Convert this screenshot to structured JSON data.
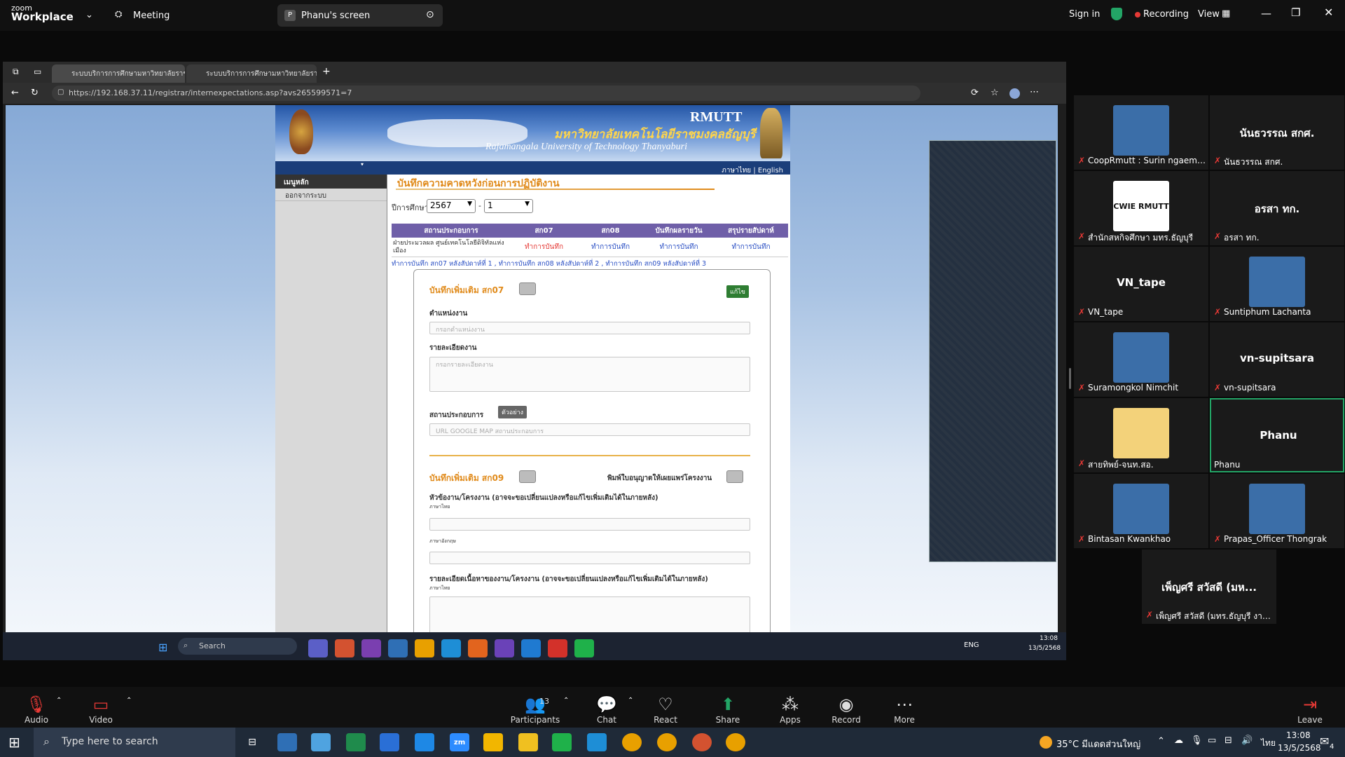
{
  "zoom_top": {
    "brand_line1": "zoom",
    "brand_line2": "Workplace",
    "meeting_label": "Meeting",
    "share_badge": "P",
    "share_label": "Phanu's screen",
    "sign_in": "Sign in",
    "recording": "Recording",
    "view": "View"
  },
  "browser": {
    "tabs": [
      {
        "title": "ระบบบริการการศึกษามหาวิทยาลัยราช..."
      },
      {
        "title": "ระบบบริการการศึกษามหาวิทยาลัยราช..."
      }
    ],
    "url": "https://192.168.37.11/registrar/internexpectations.asp?avs265599571=7"
  },
  "site": {
    "rmutt": "RMUTT",
    "thai_name": "มหาวิทยาลัยเทคโนโลยีราชมงคลธัญบุรี",
    "eng_name": "Rajamangala University of Technology Thanyaburi",
    "lang": "ภาษาไทย | English",
    "sidebar_header": "เมนูหลัก",
    "sidebar_item": "ออกจากระบบ",
    "page_title": "บันทึกความคาดหวังก่อนการปฏิบัติงาน",
    "year_label": "ปีการศึกษา",
    "year_value": "2567",
    "term_value": "1",
    "table_headers": [
      "สถานประกอบการ",
      "สก07",
      "สก08",
      "บันทึกผลรายวัน",
      "สรุปรายสัปดาห์"
    ],
    "table_row": {
      "company": "ฝ่ายประมวลผล ศูนย์เทคโนโลยีดิจิทัลแห่งเมือง",
      "c1": "ทำการบันทึก",
      "c2": "ทำการบันทึก",
      "c3": "ทำการบันทึก",
      "c4": "ทำการบันทึก"
    },
    "note": "ทำการบันทึก สก07 หลังสัปดาห์ที่ 1 , ทำการบันทึก สก08 หลังสัปดาห์ที่ 2 , ทำการบันทึก สก09 หลังสัปดาห์ที่ 3",
    "form": {
      "sec1_title": "บันทึกเพิ่มเติม สก07",
      "edit_btn": "แก้ไข",
      "position_label": "ตำแหน่งงาน",
      "position_ph": "กรอกตำแหน่งงาน",
      "detail_label": "รายละเอียดงาน",
      "detail_ph": "กรอกรายละเอียดงาน",
      "company_label": "สถานประกอบการ",
      "example_btn": "ตัวอย่าง",
      "map_ph": "URL GOOGLE MAP สถานประกอบการ",
      "sec2_title": "บันทึกเพิ่มเติม สก09",
      "print_consent": "พิมพ์ใบอนุญาตให้เผยแพร่โครงงาน",
      "project_label": "หัวข้องาน/โครงงาน (อาจจะขอเปลี่ยนแปลงหรือแก้ไขเพิ่มเติมได้ในภายหลัง)",
      "thai_small": "ภาษาไทย",
      "eng_small": "ภาษาอังกฤษ",
      "content_label": "รายละเอียดเนื้อหาของงาน/โครงงาน (อาจจะขอเปลี่ยนแปลงหรือแก้ไขเพิ่มเติมได้ในภายหลัง)",
      "thai_small2": "ภาษาไทย"
    }
  },
  "inner_taskbar": {
    "search": "Search",
    "lang": "ENG",
    "time": "13:08",
    "date": "13/5/2568"
  },
  "participants": [
    {
      "name": "CoopRmutt : Surin ngaemn...",
      "type": "photo",
      "big": ""
    },
    {
      "name": "นันธวรรณ สกศ.",
      "type": "name",
      "big": "นันธวรรณ สกศ."
    },
    {
      "name": "สำนักสหกิจศึกษา มทร.ธัญบุรี",
      "type": "logo",
      "big": "CWIE RMUTT"
    },
    {
      "name": "อรสา ทก.",
      "type": "name",
      "big": "อรสา ทก."
    },
    {
      "name": "VN_tape",
      "type": "name",
      "big": "VN_tape"
    },
    {
      "name": "Suntiphum Lachanta",
      "type": "photo",
      "big": ""
    },
    {
      "name": "Suramongkol Nimchit",
      "type": "photo",
      "big": ""
    },
    {
      "name": "vn-supitsara",
      "type": "name",
      "big": "vn-supitsara"
    },
    {
      "name": "สายทิพย์-จนท.สอ.",
      "type": "cartoon",
      "big": ""
    },
    {
      "name": "Phanu",
      "type": "active",
      "big": "Phanu"
    },
    {
      "name": "Bintasan Kwankhao",
      "type": "photo",
      "big": ""
    },
    {
      "name": "Prapas_Officer Thongrak",
      "type": "photo",
      "big": ""
    },
    {
      "name": "เพ็ญศรี สวัสดี (มทร.ธัญบุรี งาน...",
      "type": "name",
      "big": "เพ็ญศรี สวัสดี (มห..."
    }
  ],
  "zoom_bottom": {
    "audio": "Audio",
    "video": "Video",
    "participants": "Participants",
    "participants_count": "13",
    "chat": "Chat",
    "react": "React",
    "share": "Share",
    "apps": "Apps",
    "record": "Record",
    "more": "More",
    "leave": "Leave"
  },
  "windows_taskbar": {
    "search": "Type here to search",
    "weather": "35°C มีแดดส่วนใหญ่",
    "lang": "ไทย",
    "time": "13:08",
    "date": "13/5/2568",
    "notif": "4"
  },
  "colors": {
    "zoom_green": "#23a566",
    "record_red": "#e53935",
    "site_purple": "#6f5fa8",
    "site_orange": "#e08a1a"
  }
}
